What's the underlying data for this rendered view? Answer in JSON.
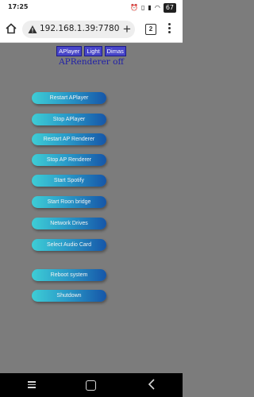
{
  "status_bar": {
    "time": "17:25",
    "battery": "67"
  },
  "browser": {
    "url": "192.168.1.39:7780",
    "tab_count": "2"
  },
  "page": {
    "top_tabs": [
      "APlayer",
      "Light",
      "Dimas"
    ],
    "renderer_status": "APRenderer off",
    "buttons": [
      "Restart APlayer",
      "Stop APlayer",
      "Restart AP Renderer",
      "Stop AP Renderer",
      "Start Spotify",
      "Start Roon bridge",
      "Network Drives",
      "Select Audio Card",
      "Reboot system",
      "Shutdown"
    ]
  },
  "colors": {
    "page_background": "#7c7c7c",
    "tab_background": "#4845c9",
    "status_text": "#1f1fa8",
    "button_gradient_start": "#3ecdd5",
    "button_gradient_end": "#1656a8"
  }
}
